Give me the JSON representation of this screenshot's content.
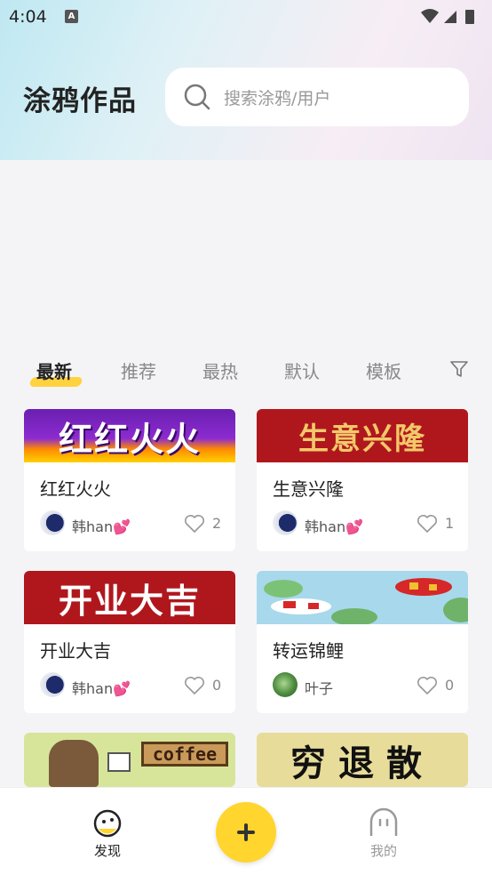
{
  "status_bar": {
    "time": "4:04",
    "notification_letter": "A"
  },
  "header": {
    "title": "涂鸦作品",
    "search_placeholder": "搜索涂鸦/用户"
  },
  "tabs": [
    {
      "label": "最新",
      "active": true
    },
    {
      "label": "推荐",
      "active": false
    },
    {
      "label": "最热",
      "active": false
    },
    {
      "label": "默认",
      "active": false
    },
    {
      "label": "模板",
      "active": false
    }
  ],
  "cards": [
    {
      "banner_text": "红红火火",
      "title": "红红火火",
      "author": "韩han💕",
      "likes": "2"
    },
    {
      "banner_text": "生意兴隆",
      "title": "生意兴隆",
      "author": "韩han💕",
      "likes": "1"
    },
    {
      "banner_text": "开业大吉",
      "title": "开业大吉",
      "author": "韩han💕",
      "likes": "0"
    },
    {
      "banner_text": "",
      "title": "转运锦鲤",
      "author": "叶子",
      "likes": "0"
    },
    {
      "banner_text": "coffee",
      "title": "",
      "author": "",
      "likes": ""
    },
    {
      "banner_text": "穷退散",
      "title": "",
      "author": "",
      "likes": ""
    }
  ],
  "bottom_nav": [
    {
      "label": "发现",
      "active": true
    },
    {
      "label": "我的",
      "active": false
    }
  ],
  "colors": {
    "accent": "#ffd52e",
    "tab_underline": "#ffd23f",
    "banner_red": "#b0171d",
    "banner_purple": "#6a1fb0"
  }
}
